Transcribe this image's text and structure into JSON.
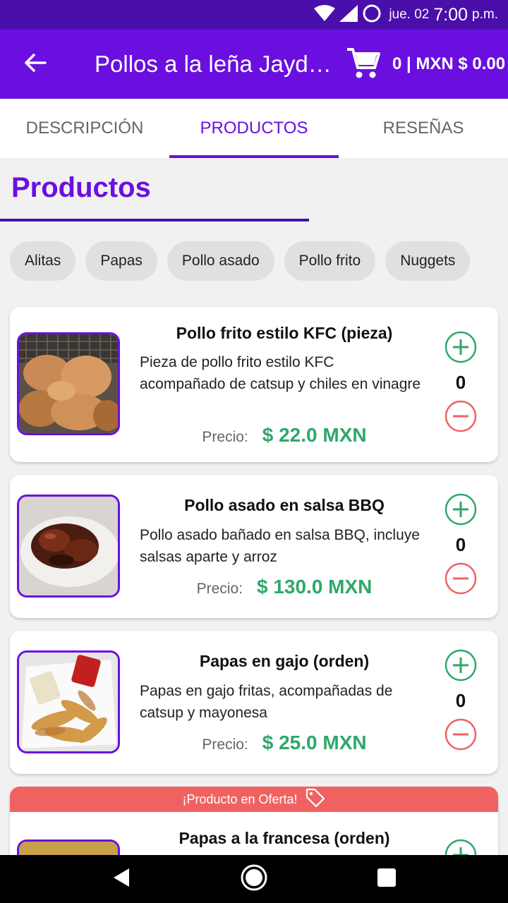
{
  "status_bar": {
    "date": "jue. 02",
    "time": "7:00",
    "ampm": "p.m."
  },
  "app_bar": {
    "title": "Pollos a la leña Jaydeen",
    "cart_total": "0 | MXN $ 0.00"
  },
  "tabs": [
    {
      "label": "DESCRIPCIÓN"
    },
    {
      "label": "PRODUCTOS"
    },
    {
      "label": "RESEÑAS"
    }
  ],
  "section": {
    "title": "Productos"
  },
  "categories": [
    "Alitas",
    "Papas",
    "Pollo asado",
    "Pollo frito",
    "Nuggets"
  ],
  "products": [
    {
      "name": "Pollo frito estilo KFC (pieza)",
      "description": "Pieza de pollo frito estilo KFC acompañado de catsup y chiles en vinagre",
      "price_label": "Precio:",
      "price": "$ 22.0 MXN",
      "quantity": "0"
    },
    {
      "name": "Pollo asado en salsa BBQ",
      "description": "Pollo asado bañado en salsa BBQ, incluye salsas aparte y arroz",
      "price_label": "Precio:",
      "price": "$ 130.0 MXN",
      "quantity": "0"
    },
    {
      "name": "Papas en gajo (orden)",
      "description": "Papas en gajo fritas, acompañadas de catsup y mayonesa",
      "price_label": "Precio:",
      "price": "$ 25.0 MXN",
      "quantity": "0"
    },
    {
      "offer_label": "¡Producto en Oferta!",
      "name": "Papas a la francesa (orden)"
    }
  ],
  "colors": {
    "primary": "#6a0fe0",
    "status_bar": "#4a0eab",
    "price": "#2ea86a",
    "add": "#2ea86a",
    "remove": "#f06262",
    "offer": "#f06262"
  },
  "icons": {
    "back": "arrow-left-icon",
    "cart": "shopping-cart-icon",
    "add": "plus-circle-icon",
    "remove": "minus-circle-icon",
    "offer": "tag-icon"
  }
}
